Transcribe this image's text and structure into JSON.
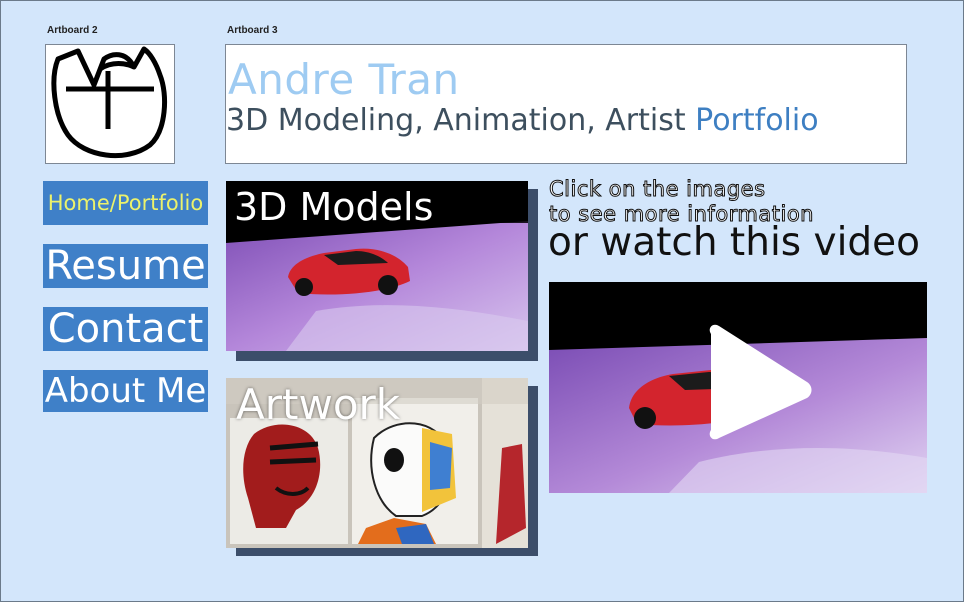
{
  "artboards": {
    "left_label": "Artboard 2",
    "right_label": "Artboard 3"
  },
  "header": {
    "title": "Andre Tran",
    "subtitle_main": "3D Modeling, Animation, Artist ",
    "subtitle_accent": "Portfolio"
  },
  "nav": {
    "home": "Home/Portfolio",
    "resume": "Resume",
    "contact": "Contact",
    "about": "About Me"
  },
  "cards": {
    "models_title": "3D Models",
    "artwork_title": "Artwork"
  },
  "instructions": {
    "line1": "Click on the images",
    "line2": "to see more information",
    "line3": "or watch this video"
  },
  "icons": [
    "logo-at-monogram-icon",
    "play-icon",
    "car-icon"
  ],
  "colors": {
    "background": "#d3e6fb",
    "nav_button": "#3f80c8",
    "nav_active_text": "#ecf26b",
    "title_light_blue": "#9ecbf2",
    "accent_blue": "#3e7fc2"
  }
}
